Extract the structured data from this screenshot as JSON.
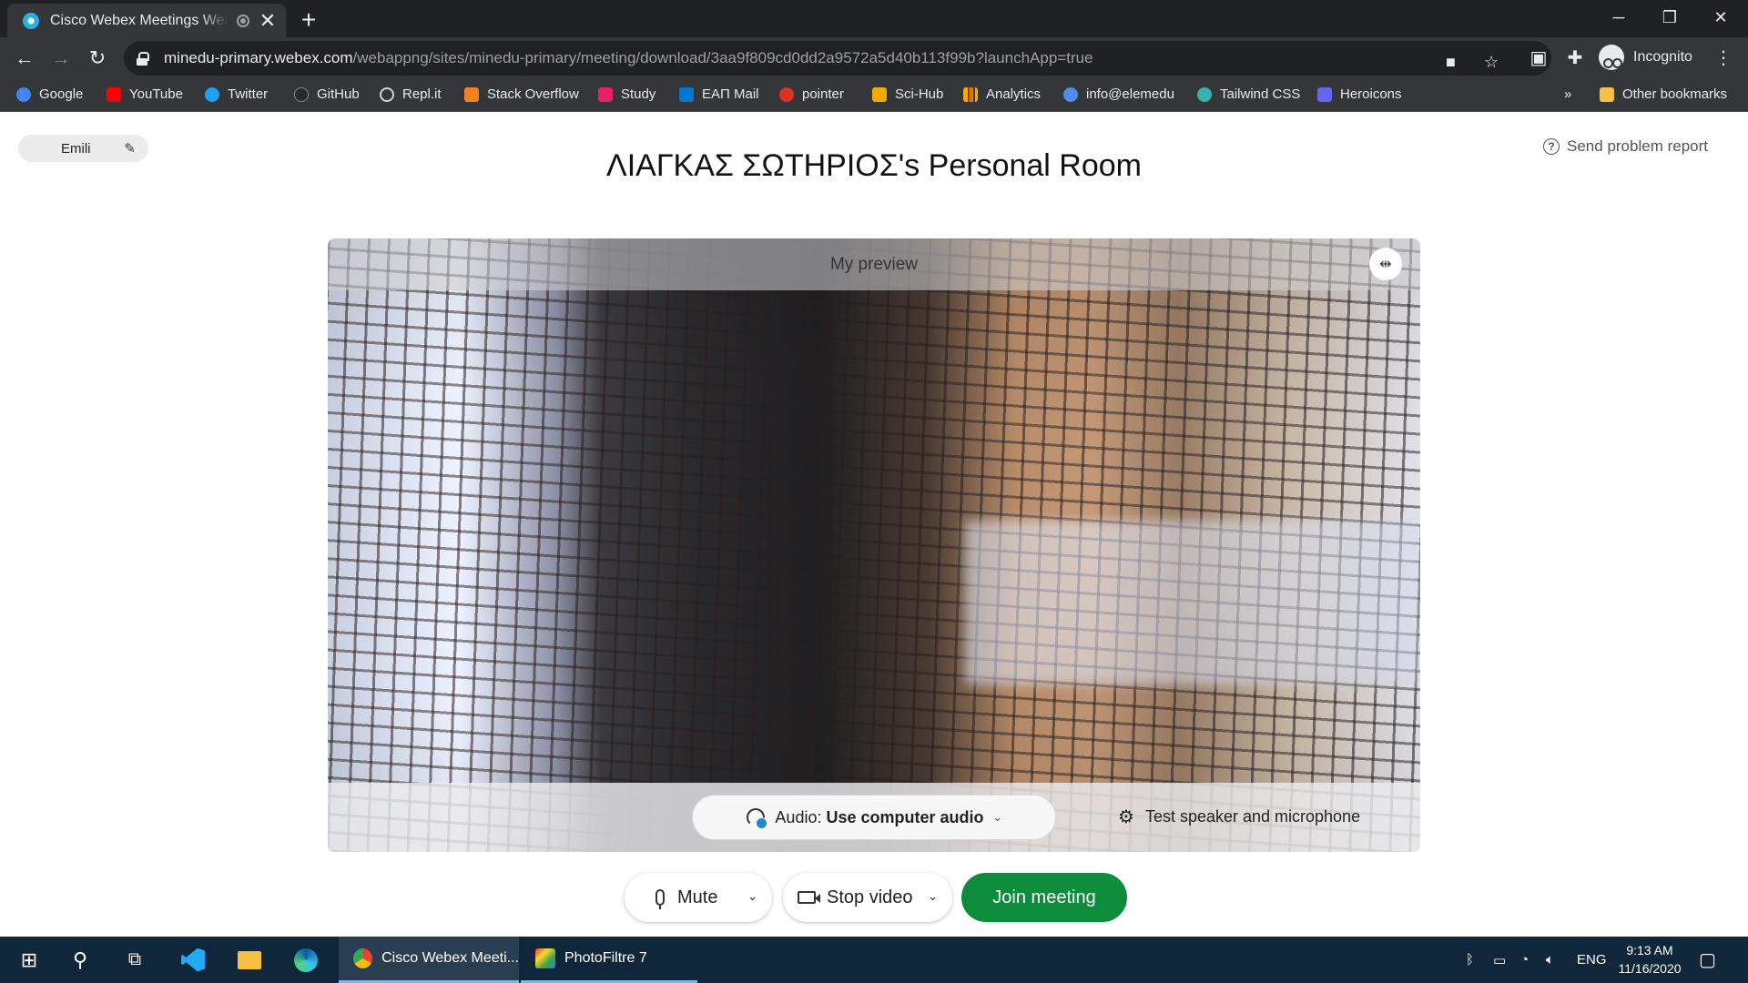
{
  "browser": {
    "tab_title": "Cisco Webex Meetings Web",
    "tab_close": "✕",
    "new_tab": "+",
    "url_host": "minedu-primary.webex.com",
    "url_path": "/webappng/sites/minedu-primary/meeting/download/3aa9f809cd0dd2a9572a5d40b113f99b?launchApp=true",
    "profile_label": "Incognito",
    "bookmarks": [
      {
        "label": "Google",
        "color": "#4285f4"
      },
      {
        "label": "YouTube",
        "color": "#ff0000"
      },
      {
        "label": "Twitter",
        "color": "#1da1f2"
      },
      {
        "label": "GitHub",
        "color": "#24292e"
      },
      {
        "label": "Repl.it",
        "color": "#d3d3d3"
      },
      {
        "label": "Stack Overflow",
        "color": "#f48024"
      },
      {
        "label": "Study",
        "color": "#e91e63"
      },
      {
        "label": "ΕΑΠ Mail",
        "color": "#0078d4"
      },
      {
        "label": "pointer",
        "color": "#e0301e"
      },
      {
        "label": "Sci-Hub",
        "color": "#f2a900"
      },
      {
        "label": "Analytics",
        "color": "#f9ab00"
      },
      {
        "label": "info@elemedu",
        "color": "#4f8ee6"
      },
      {
        "label": "Tailwind CSS",
        "color": "#38b2ac"
      },
      {
        "label": "Heroicons",
        "color": "#6366f1"
      }
    ],
    "bookmarks_overflow": "»",
    "other_bookmarks": "Other bookmarks"
  },
  "webex": {
    "user_name": "Emili",
    "report_label": "Send problem report",
    "room_title": "ΛΙΑΓΚΑΣ ΣΩΤΗΡΙΟΣ's Personal Room",
    "preview_label": "My preview",
    "audio_prefix": "Audio:",
    "audio_value": "Use computer audio",
    "test_label": "Test speaker and microphone",
    "mute_label": "Mute",
    "video_label": "Stop video",
    "join_label": "Join meeting",
    "accent_color": "#0d8c3c"
  },
  "taskbar": {
    "apps": [
      {
        "label": "Cisco Webex Meeti...",
        "state": "active"
      },
      {
        "label": "PhotoFiltre 7",
        "state": "open"
      }
    ],
    "language": "ENG",
    "time": "9:13 AM",
    "date": "11/16/2020"
  }
}
